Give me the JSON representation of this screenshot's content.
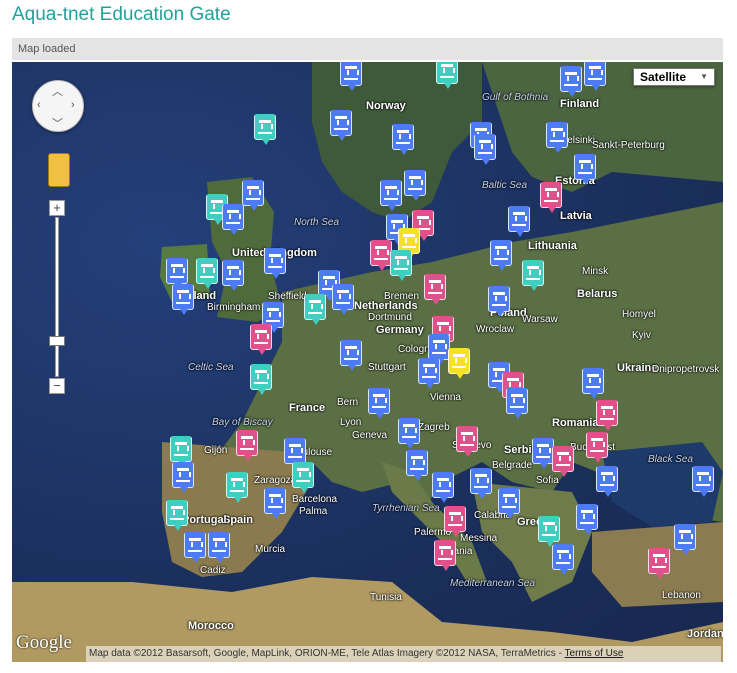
{
  "page": {
    "title": "Aqua-tnet Education Gate",
    "status": "Map loaded"
  },
  "map": {
    "map_type": "Satellite",
    "google_logo": "Google",
    "attribution": "Map data ©2012 Basarsoft, Google, MapLink, ORION-ME, Tele Atlas Imagery ©2012 NASA, TerraMetrics -",
    "terms_link": "Terms of Use",
    "zoom_plus": "+",
    "zoom_minus": "−",
    "zoom_minus_small": "−",
    "labels": {
      "norway": "Norway",
      "finland": "Finland",
      "gulf_bothnia": "Gulf of Bothnia",
      "helsinki": "Helsinki",
      "st_petersburg": "Sankt-Peterburg",
      "estonia": "Estonia",
      "baltic_sea": "Baltic Sea",
      "latvia": "Latvia",
      "north_sea": "North Sea",
      "lithuania": "Lithuania",
      "united_kingdom": "United Kingdom",
      "minsk": "Minsk",
      "belarus": "Belarus",
      "bremen": "Bremen",
      "ireland": "Ireland",
      "sheffield": "Sheffield",
      "birmingham": "Birmingham",
      "netherlands": "Netherlands",
      "dortmund": "Dortmund",
      "poland": "Poland",
      "warsaw": "Warsaw",
      "germany": "Germany",
      "wroclaw": "Wroclaw",
      "kyiv": "Kyiv",
      "homyel": "Homyel",
      "celtic_sea": "Celtic Sea",
      "cologne": "Cologne",
      "stuttgart": "Stuttgart",
      "ukraine": "Ukraine",
      "dnipro": "Dnipropetrovsk",
      "france": "France",
      "bern": "Bern",
      "vienna": "Vienna",
      "zagreb": "Zagreb",
      "romania": "Romania",
      "bay_biscay": "Bay of Biscay",
      "lyon": "Lyon",
      "geneva": "Geneva",
      "bucharest": "Bucharest",
      "black_sea": "Black Sea",
      "gijon": "Gijón",
      "toulouse": "Toulouse",
      "serbia": "Serbia",
      "zaragoza": "Zaragoza",
      "barcelona": "Barcelona",
      "sofia": "Sofia",
      "spain": "Spain",
      "palma": "Palma",
      "tyrrhenian_sea": "Tyrrhenian Sea",
      "portugal": "Portugal",
      "murcia": "Murcia",
      "cadiz": "Cadiz",
      "palermo": "Palermo",
      "messina": "Messina",
      "catania": "Catania",
      "calabria": "Calabria",
      "greece": "Greece",
      "mediterranean_sea": "Mediterranean Sea",
      "morocco": "Morocco",
      "tunisia": "Tunisia",
      "lebanon": "Lebanon",
      "jordan": "Jordan",
      "sarajevo": "Sarajevo",
      "belgrade": "Belgrade"
    },
    "marker_colors": {
      "university": "#4d7bf3",
      "school": "#3ecfc0",
      "institute": "#e0508a",
      "office": "#f5e227"
    }
  }
}
